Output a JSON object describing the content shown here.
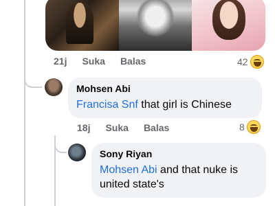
{
  "post_reactions": {
    "time": "21j",
    "like_label": "Suka",
    "reply_label": "Balas",
    "count": "42",
    "reaction_icon": "haha-emoji-icon"
  },
  "comments": [
    {
      "author": "Mohsen Abi",
      "mention": "Francisa Snf",
      "text": " that girl is Chinese",
      "time": "18j",
      "like_label": "Suka",
      "reply_label": "Balas",
      "reaction_count": "8"
    },
    {
      "author": "Sony Riyan",
      "mention": "Mohsen Abi",
      "text": " and that nuke is united state's"
    }
  ],
  "colors": {
    "mention": "#216fdb",
    "bubble": "#f0f2f5",
    "meta": "#65676b"
  }
}
